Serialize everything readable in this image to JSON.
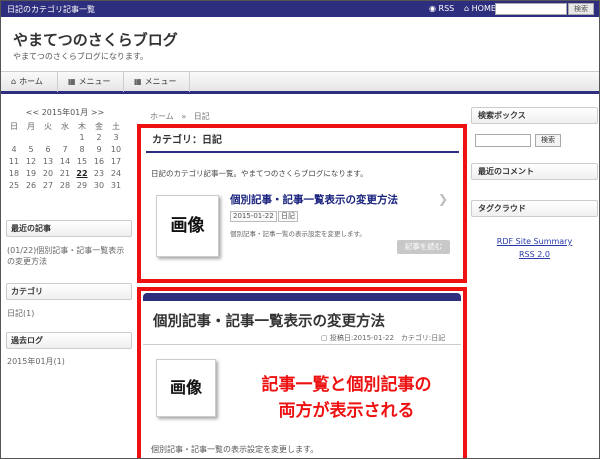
{
  "topbar": {
    "title": "日記のカテゴリ記事一覧",
    "rss": "RSS",
    "home": "HOME",
    "search_button": "検索"
  },
  "header": {
    "site_title": "やまてつのさくらブログ",
    "site_desc": "やまてつのさくらブログになります。"
  },
  "nav": {
    "items": [
      {
        "label": "ホーム",
        "icon": "home-icon"
      },
      {
        "label": "メニュー",
        "icon": "grid-icon"
      },
      {
        "label": "メニュー",
        "icon": "grid-icon"
      }
    ]
  },
  "calendar": {
    "month": "2015年01月",
    "prev": "<<",
    "next": ">>",
    "weekdays": [
      "日",
      "月",
      "火",
      "水",
      "木",
      "金",
      "土"
    ],
    "weeks": [
      [
        "",
        "",
        "",
        "",
        "1",
        "2",
        "3"
      ],
      [
        "4",
        "5",
        "6",
        "7",
        "8",
        "9",
        "10"
      ],
      [
        "11",
        "12",
        "13",
        "14",
        "15",
        "16",
        "17"
      ],
      [
        "18",
        "19",
        "20",
        "21",
        "22",
        "23",
        "24"
      ],
      [
        "25",
        "26",
        "27",
        "28",
        "29",
        "30",
        "31"
      ]
    ]
  },
  "left_widgets": {
    "recent_title": "最近の記事",
    "recent_item": "(01/22)個別記事・記事一覧表示の変更方法",
    "category_title": "カテゴリ",
    "category_item": "日記(1)",
    "archive_title": "過去ログ",
    "archive_item": "2015年01月(1)"
  },
  "right_widgets": {
    "search_title": "検索ボックス",
    "search_button": "検索",
    "comments_title": "最近のコメント",
    "tagcloud_title": "タグクラウド",
    "rdf_link": "RDF Site Summary",
    "rss_link": "RSS 2.0"
  },
  "breadcrumb": {
    "home": "ホーム",
    "sep": "»",
    "current": "日記"
  },
  "category_box": {
    "heading": "カテゴリ：日記",
    "description": "日記のカテゴリ記事一覧。やまてつのさくらブログになります。",
    "card": {
      "image_label": "画像",
      "title": "個別記事・記事一覧表示の変更方法",
      "date": "2015-01-22",
      "tag": "日記",
      "excerpt": "個別記事・記事一覧の表示設定を変更します。",
      "read_more": "記事を読む"
    }
  },
  "post": {
    "title": "個別記事・記事一覧表示の変更方法",
    "meta": "投稿日:2015-01-22　カテゴリ:日記",
    "image_label": "画像",
    "excerpt": "個別記事・記事一覧の表示設定を変更します。"
  },
  "annotation": {
    "line1": "記事一覧と個別記事の",
    "line2": "両方が表示される",
    "color": "#ee1111"
  },
  "colors": {
    "accent": "#2e2e7e",
    "highlight": "#ee1111"
  }
}
